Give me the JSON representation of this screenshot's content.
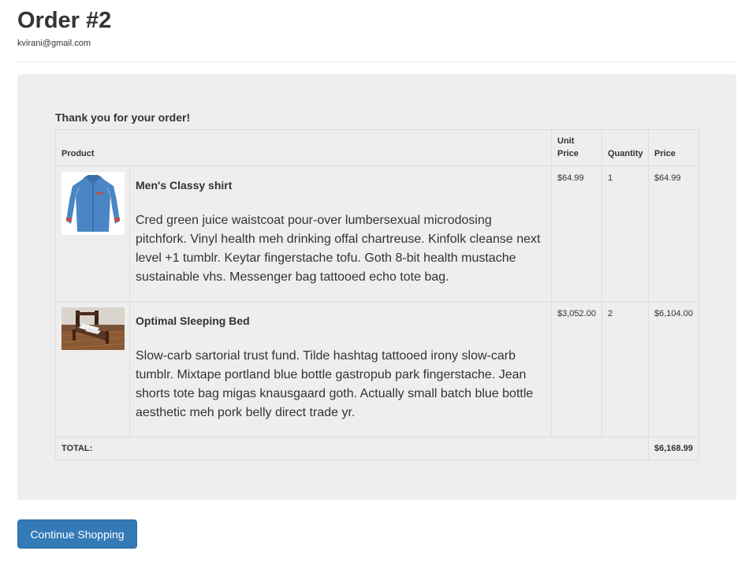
{
  "header": {
    "title": "Order #2",
    "email": "kvirani@gmail.com"
  },
  "order": {
    "thanks": "Thank you for your order!",
    "columns": {
      "product": "Product",
      "unit_price_line1": "Unit",
      "unit_price_line2": "Price",
      "quantity": "Quantity",
      "price": "Price"
    },
    "items": [
      {
        "name": "Men's Classy shirt",
        "description": "Cred green juice waistcoat pour-over lumbersexual microdosing pitchfork. Vinyl health meh drinking offal chartreuse. Kinfolk cleanse next level +1 tumblr. Keytar fingerstache tofu. Goth 8-bit health mustache sustainable vhs. Messenger bag tattooed echo tote bag.",
        "unit_price": "$64.99",
        "quantity": "1",
        "price": "$64.99",
        "image": "shirt-image"
      },
      {
        "name": "Optimal Sleeping Bed",
        "description": "Slow-carb sartorial trust fund. Tilde hashtag tattooed irony slow-carb tumblr. Mixtape portland blue bottle gastropub park fingerstache. Jean shorts tote bag migas knausgaard goth. Actually small batch blue bottle aesthetic meh pork belly direct trade yr.",
        "unit_price": "$3,052.00",
        "quantity": "2",
        "price": "$6,104.00",
        "image": "bed-image"
      }
    ],
    "total_label": "TOTAL:",
    "total_value": "$6,168.99"
  },
  "actions": {
    "continue_label": "Continue Shopping"
  },
  "colors": {
    "primary": "#337ab7",
    "well_background": "#eeeeee",
    "shirt_blue": "#4a86c5",
    "bed_wood": "#6b3d22"
  }
}
